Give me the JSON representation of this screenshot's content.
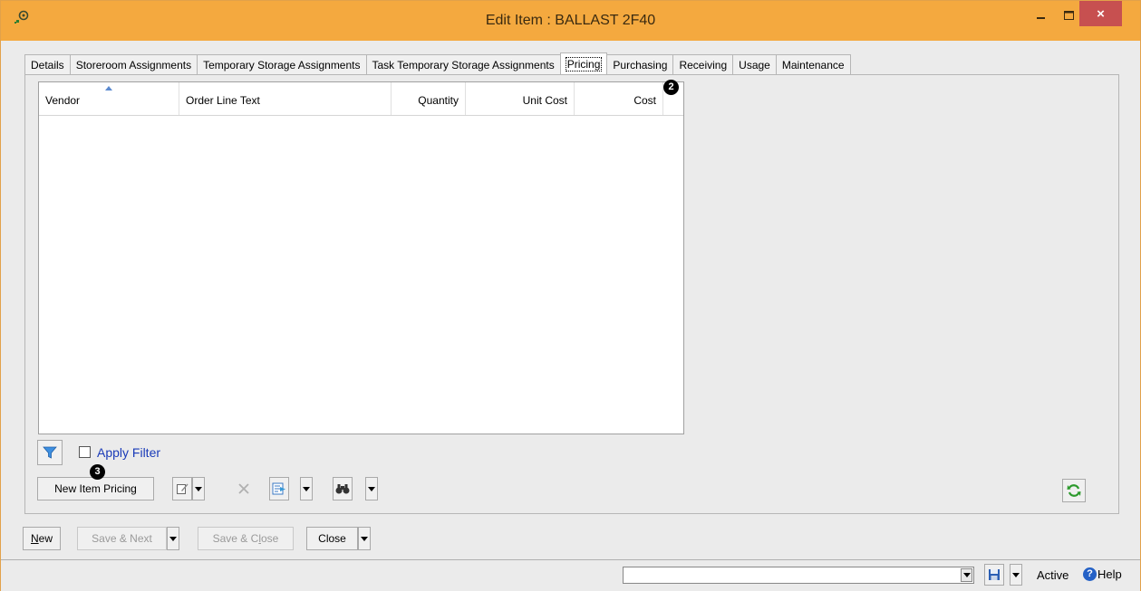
{
  "window": {
    "title": "Edit Item : BALLAST 2F40",
    "close_glyph": "×"
  },
  "tabs": [
    {
      "label": "Details"
    },
    {
      "label": "Storeroom Assignments"
    },
    {
      "label": "Temporary Storage Assignments"
    },
    {
      "label": "Task Temporary Storage Assignments"
    },
    {
      "label": "Pricing",
      "active": true
    },
    {
      "label": "Purchasing"
    },
    {
      "label": "Receiving"
    },
    {
      "label": "Usage"
    },
    {
      "label": "Maintenance"
    }
  ],
  "grid": {
    "columns": [
      "Vendor",
      "Order Line Text",
      "Quantity",
      "Unit Cost",
      "Cost"
    ],
    "sorted_column": "Vendor",
    "rows": []
  },
  "callouts": {
    "badge_2": "2",
    "badge_3": "3"
  },
  "filter": {
    "checkbox_label": "Apply Filter",
    "checked": false,
    "icon": "funnel-icon"
  },
  "toolbar": {
    "new_item_pricing": "New Item Pricing",
    "edit_icon": "edit-icon",
    "delete_icon": "delete-icon",
    "export_icon": "export-icon",
    "find_icon": "binoculars-icon",
    "refresh_icon": "refresh-icon"
  },
  "footer": {
    "new_label_u": "N",
    "new_label_rest": "ew",
    "save_next": "Save & Next",
    "save_close_pre": "Save & C",
    "save_close_u": "l",
    "save_close_post": "ose",
    "close": "Close"
  },
  "statusbar": {
    "combo_value": "",
    "status": "Active",
    "help": "Help",
    "help_glyph": "?"
  },
  "colors": {
    "titlebar": "#f4a93f",
    "close_button": "#c75050",
    "link_blue": "#1a3bb8",
    "panel_bg": "#ebebeb"
  }
}
